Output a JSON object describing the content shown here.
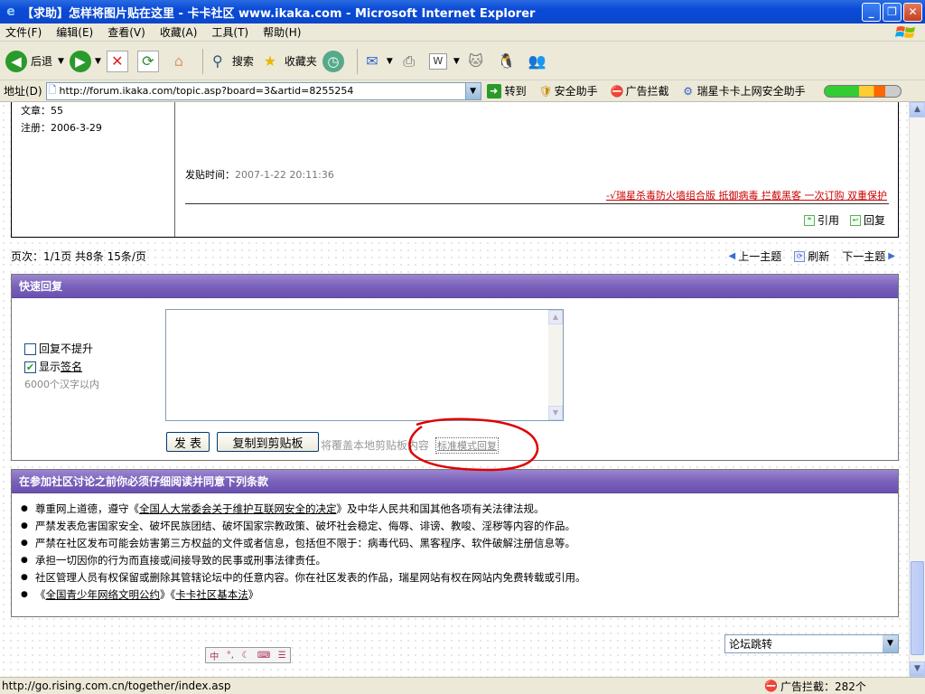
{
  "window": {
    "title": "【求助】怎样将图片贴在这里 - 卡卡社区 www.ikaka.com - Microsoft Internet Explorer",
    "minimize": "_",
    "restore": "❐",
    "close": "✕"
  },
  "menu": [
    "文件(F)",
    "编辑(E)",
    "查看(V)",
    "收藏(A)",
    "工具(T)",
    "帮助(H)"
  ],
  "toolbar": {
    "back": "后退",
    "search": "搜索",
    "favorites": "收藏夹"
  },
  "address": {
    "label": "地址(D)",
    "url": "http://forum.ikaka.com/topic.asp?board=3&artid=8255254",
    "go": "转到",
    "links": [
      "安全助手",
      "广告拦截",
      "瑞星卡卡上网安全助手"
    ]
  },
  "post": {
    "articles": "文章：55",
    "registered": "注册：2006-3-29",
    "time_label": "发贴时间：",
    "time_value": "2007-1-22 20:11:36",
    "ad": "-√瑞星杀毒防火墙组合版 抵御病毒 拦截黑客 一次订购 双重保护",
    "quote": "引用",
    "reply": "回复"
  },
  "pager": {
    "info": "页次：1/1页 共8条 15条/页",
    "prev": "上一主题",
    "refresh": "刷新",
    "next": "下一主题"
  },
  "quick_reply": {
    "title": "快速回复",
    "no_bump": "回复不提升",
    "show_sig_prefix": "显示",
    "show_sig_link": "签名",
    "limit": "6000个汉字以内",
    "submit": "发 表",
    "copy": "复制到剪贴板",
    "note": "将覆盖本地剪贴板内容",
    "mode": "标准模式回复"
  },
  "rules": {
    "title": "在参加社区讨论之前你必须仔细阅读并同意下列条款",
    "items": [
      {
        "pre": "尊重网上道德，遵守《",
        "link": "全国人大常委会关于维护互联网安全的决定",
        "post": "》及中华人民共和国其他各项有关法律法规。"
      },
      {
        "pre": "严禁发表危害国家安全、破坏民族团结、破坏国家宗教政策、破坏社会稳定、侮辱、诽谤、教唆、淫秽等内容的作品。",
        "link": "",
        "post": ""
      },
      {
        "pre": "严禁在社区发布可能会妨害第三方权益的文件或者信息，包括但不限于：病毒代码、黑客程序、软件破解注册信息等。",
        "link": "",
        "post": ""
      },
      {
        "pre": "承担一切因你的行为而直接或间接导致的民事或刑事法律责任。",
        "link": "",
        "post": ""
      },
      {
        "pre": "社区管理人员有权保留或删除其管辖论坛中的任意内容。你在社区发表的作品，瑞星网站有权在网站内免费转载或引用。",
        "link": "",
        "post": ""
      }
    ],
    "last_pre": "《",
    "last_link1": "全国青少年网络文明公约",
    "last_mid": "》《",
    "last_link2": "卡卡社区基本法",
    "last_post": "》"
  },
  "forum_jump": "论坛跳转",
  "status": {
    "url": "http://go.rising.com.cn/together/index.asp",
    "ad_block": "广告拦截：282个"
  },
  "colors": {
    "titlebar": "#0a4ad8",
    "purple_header": "#7a62bb",
    "ad_red": "#cc0000",
    "annotation_red": "#e00000"
  }
}
